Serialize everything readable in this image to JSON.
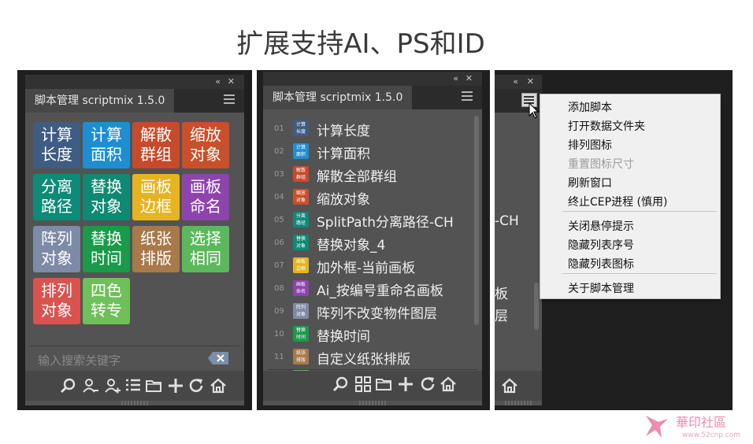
{
  "heading": "扩展支持AI、PS和ID",
  "colors": {
    "navy": "#3f5c82",
    "blue": "#1f8ed1",
    "red_orange": "#c64b2b",
    "orange_red": "#c8502b",
    "teal": "#0f8a78",
    "teal2": "#0e8a73",
    "yellow": "#e6b422",
    "purple": "#8e44ad",
    "gray_blue": "#7e8aa6",
    "green": "#1a9a4a",
    "brown": "#a8794a",
    "light_green": "#5cb85c",
    "coral": "#d9534f",
    "lime": "#6fbf5a"
  },
  "panel1": {
    "collapse_glyph": "«",
    "close_glyph": "✕",
    "tab": "脚本管理 scriptmix 1.5.0",
    "tiles": [
      {
        "line1": "计算",
        "line2": "长度",
        "color": "#3f5c82"
      },
      {
        "line1": "计算",
        "line2": "面积",
        "color": "#1f8ed1"
      },
      {
        "line1": "解散",
        "line2": "群组",
        "color": "#c64b2b"
      },
      {
        "line1": "缩放",
        "line2": "对象",
        "color": "#c8502b"
      },
      {
        "line1": "分离",
        "line2": "路径",
        "color": "#0f8a78"
      },
      {
        "line1": "替换",
        "line2": "对象",
        "color": "#0e8a73"
      },
      {
        "line1": "画板",
        "line2": "边框",
        "color": "#e6b422"
      },
      {
        "line1": "画板",
        "line2": "命名",
        "color": "#8e44ad"
      },
      {
        "line1": "阵列",
        "line2": "对象",
        "color": "#7e8aa6"
      },
      {
        "line1": "替换",
        "line2": "时间",
        "color": "#1a9a4a"
      },
      {
        "line1": "纸张",
        "line2": "排版",
        "color": "#a8794a"
      },
      {
        "line1": "选择",
        "line2": "相同",
        "color": "#5cb85c"
      },
      {
        "line1": "排列",
        "line2": "对象",
        "color": "#d9534f"
      },
      {
        "line1": "四色",
        "line2": "转专",
        "color": "#6fbf5a"
      }
    ],
    "search_placeholder": "输入搜索关键字",
    "clear_icon": "✕",
    "toolbar_icons": [
      "search-icon",
      "remove-user-icon",
      "add-user-icon",
      "list-icon",
      "folder-icon",
      "plus-icon",
      "refresh-icon",
      "home-icon"
    ]
  },
  "panel2": {
    "collapse_glyph": "«",
    "close_glyph": "✕",
    "tab": "脚本管理 scriptmix 1.5.0",
    "rows": [
      {
        "num": "01",
        "i1": "计算",
        "i2": "长度",
        "label": "计算长度",
        "color": "#3f5c82"
      },
      {
        "num": "02",
        "i1": "计算",
        "i2": "面积",
        "label": "计算面积",
        "color": "#1f8ed1"
      },
      {
        "num": "03",
        "i1": "解散",
        "i2": "群组",
        "label": "解散全部群组",
        "color": "#c64b2b"
      },
      {
        "num": "04",
        "i1": "缩放",
        "i2": "对象",
        "label": "缩放对象",
        "color": "#c8502b"
      },
      {
        "num": "05",
        "i1": "分离",
        "i2": "路径",
        "label": "SplitPath分离路径-CH",
        "color": "#0f8a78"
      },
      {
        "num": "06",
        "i1": "替换",
        "i2": "对象",
        "label": "替换对象_4",
        "color": "#0e8a73"
      },
      {
        "num": "07",
        "i1": "画板",
        "i2": "边框",
        "label": "加外框-当前画板",
        "color": "#e6b422"
      },
      {
        "num": "08",
        "i1": "画板",
        "i2": "命名",
        "label": "Ai_按编号重命名画板",
        "color": "#8e44ad"
      },
      {
        "num": "09",
        "i1": "阵列",
        "i2": "对象",
        "label": "阵列不改变物件图层",
        "color": "#7e8aa6"
      },
      {
        "num": "10",
        "i1": "替换",
        "i2": "时间",
        "label": "替换时间",
        "color": "#1a9a4a"
      },
      {
        "num": "11",
        "i1": "纸张",
        "i2": "排版",
        "label": "自定义纸张排版",
        "color": "#a8794a"
      }
    ],
    "toolbar_icons": [
      "search-icon",
      "grid-icon",
      "folder-icon",
      "plus-icon",
      "refresh-icon",
      "home-icon"
    ]
  },
  "panel3": {
    "collapse_glyph": "«",
    "close_glyph": "✕",
    "partial_texts": [
      "-CH",
      "板",
      "层"
    ],
    "menu": {
      "items": [
        {
          "label": "添加脚本",
          "disabled": false
        },
        {
          "label": "打开数据文件夹",
          "disabled": false
        },
        {
          "label": "排列图标",
          "disabled": false
        },
        {
          "label": "重置图标尺寸",
          "disabled": true
        },
        {
          "label": "刷新窗口",
          "disabled": false
        },
        {
          "label": "终止CEP进程 (慎用)",
          "disabled": false
        },
        {
          "label": "关闭悬停提示",
          "disabled": false
        },
        {
          "label": "隐藏列表序号",
          "disabled": false
        },
        {
          "label": "隐藏列表图标",
          "disabled": false
        },
        {
          "label": "关于脚本管理",
          "disabled": false
        }
      ]
    }
  },
  "watermark": {
    "text": "華印社區",
    "url": "www.52cnp.com"
  }
}
